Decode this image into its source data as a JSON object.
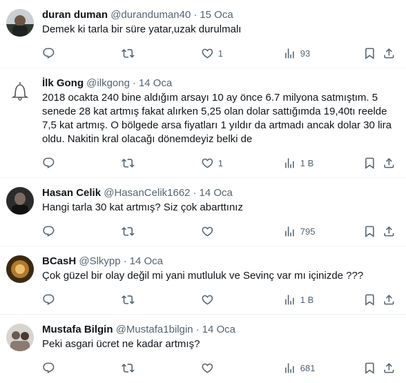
{
  "tweets": [
    {
      "name": "duran duman",
      "handle": "@duranduman40",
      "date": "15 Oca",
      "text": "Demek ki tarla bir süre yatar,uzak durulmalı",
      "likes": "1",
      "views": "93"
    },
    {
      "name": "İlk Gong",
      "handle": "@ilkgong",
      "date": "14 Oca",
      "text": "2018 ocakta 240 bine aldığım arsayı 10 ay önce 6.7 milyona satmıştım. 5 senede 28 kat artmış fakat alırken 5,25 olan dolar sattığımda 19,40tı reelde 7,5 kat artmış. O bölgede arsa fiyatları 1 yıldır da artmadı ancak dolar 30 lira oldu. Nakitin kral olacağı dönemdeyiz belki de",
      "likes": "1",
      "views": "1 B"
    },
    {
      "name": "Hasan Celik",
      "handle": "@HasanCelik1662",
      "date": "14 Oca",
      "text": "Hangi tarla 30 kat artmış? Siz çok abarttınız",
      "likes": "",
      "views": "795"
    },
    {
      "name": "BCasH",
      "handle": "@Slkypp",
      "date": "14 Oca",
      "text": "Çok güzel bir olay değil mi yani mutluluk ve Sevinç var mı içinizde ???",
      "likes": "",
      "views": "1 B"
    },
    {
      "name": "Mustafa Bilgin",
      "handle": "@Mustafa1bilgin",
      "date": "14 Oca",
      "text": "Peki asgari ücret ne kadar artmış?",
      "likes": "",
      "views": "681"
    }
  ],
  "header_separator": "·",
  "colors": {
    "text_primary": "#0f1419",
    "text_secondary": "#536471",
    "divider": "#eff3f4"
  },
  "icons": [
    "reply-icon",
    "retweet-icon",
    "like-icon",
    "views-icon",
    "bookmark-icon",
    "share-icon"
  ]
}
